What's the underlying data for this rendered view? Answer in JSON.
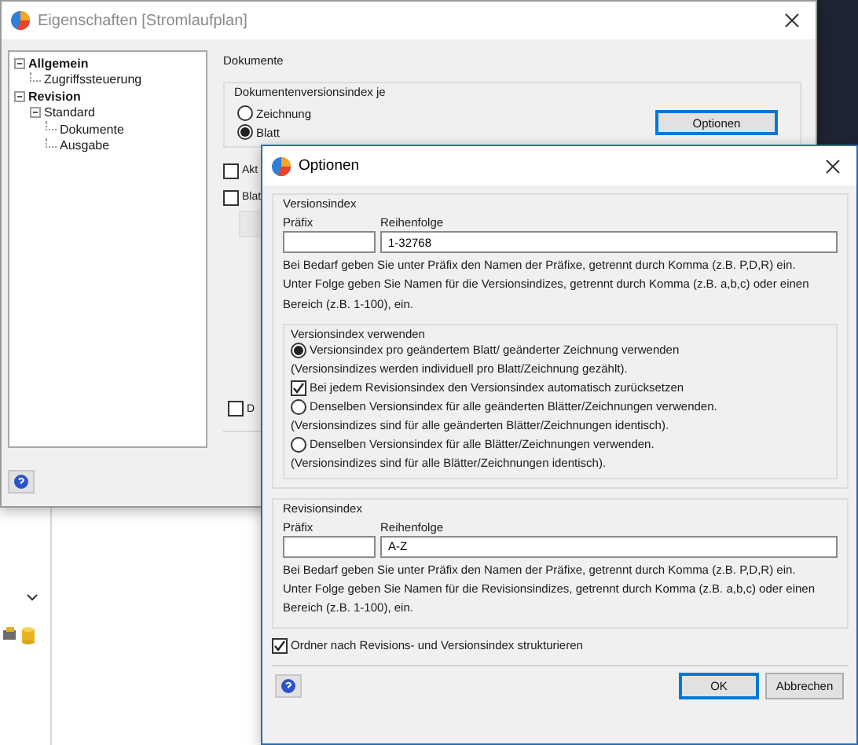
{
  "main_window": {
    "title": "Eigenschaften [Stromlaufplan]",
    "tree": [
      {
        "label": "Allgemein",
        "expanded": true,
        "children": [
          {
            "label": "Zugriffssteuerung"
          }
        ]
      },
      {
        "label": "Revision",
        "expanded": true,
        "children": [
          {
            "label": "Standard",
            "expanded": true,
            "children": [
              {
                "label": "Dokumente"
              },
              {
                "label": "Ausgabe"
              }
            ]
          }
        ]
      }
    ],
    "section_title": "Dokumente",
    "version_group": {
      "title": "Dokumentenversionsindex je",
      "options": [
        {
          "label": "Zeichnung",
          "selected": false
        },
        {
          "label": "Blatt",
          "selected": true
        }
      ],
      "button": "Optionen"
    },
    "checkboxes": [
      {
        "label": "Akt",
        "checked": false
      },
      {
        "label": "Blat",
        "checked": false
      }
    ],
    "bottom_checkbox": {
      "label": "D",
      "checked": false
    }
  },
  "dialog": {
    "title": "Optionen",
    "version_index": {
      "title": "Versionsindex",
      "prefix_label": "Präfix",
      "sequence_label": "Reihenfolge",
      "sequence_value": "1-32768",
      "hint": [
        "Bei Bedarf geben Sie unter Präfix den Namen der Präfixe, getrennt durch Komma (z.B. P,D,R) ein.",
        "Unter Folge geben Sie Namen für die Versionsindizes, getrennt durch Komma (z.B. a,b,c) oder einen Bereich (z.B. 1-100), ein."
      ],
      "usage": {
        "title": "Versionsindex verwenden",
        "items": [
          {
            "kind": "radio",
            "label": "Versionsindex pro geändertem Blatt/ geänderter Zeichnung verwenden",
            "selected": true
          },
          {
            "kind": "note",
            "label": "(Versionsindizes werden individuell pro Blatt/Zeichnung gezählt)."
          },
          {
            "kind": "checkbox",
            "label": "Bei jedem Revisionsindex den Versionsindex automatisch zurücksetzen",
            "checked": true
          },
          {
            "kind": "radio",
            "label": "Denselben Versionsindex für alle geänderten Blätter/Zeichnungen verwenden.",
            "selected": false
          },
          {
            "kind": "note",
            "label": "(Versionsindizes sind für alle geänderten Blätter/Zeichnungen identisch)."
          },
          {
            "kind": "radio",
            "label": "Denselben Versionsindex für alle Blätter/Zeichnungen verwenden.",
            "selected": false
          },
          {
            "kind": "note",
            "label": "(Versionsindizes sind für alle Blätter/Zeichnungen identisch)."
          }
        ]
      }
    },
    "revision_index": {
      "title": "Revisionsindex",
      "prefix_label": "Präfix",
      "sequence_label": "Reihenfolge",
      "sequence_value": "A-Z",
      "hint": [
        "Bei Bedarf geben Sie unter Präfix den Namen der Präfixe, getrennt durch Komma (z.B. P,D,R) ein.",
        "Unter Folge geben Sie Namen für die Revisionsindizes, getrennt durch Komma (z.B. a,b,c) oder einen Bereich (z.B. 1-100), ein."
      ]
    },
    "structure_checkbox": {
      "label": "Ordner nach Revisions- und Versionsindex strukturieren",
      "checked": true
    },
    "buttons": [
      {
        "label": "OK",
        "default": true
      },
      {
        "label": "Abbrechen",
        "default": false
      }
    ]
  }
}
